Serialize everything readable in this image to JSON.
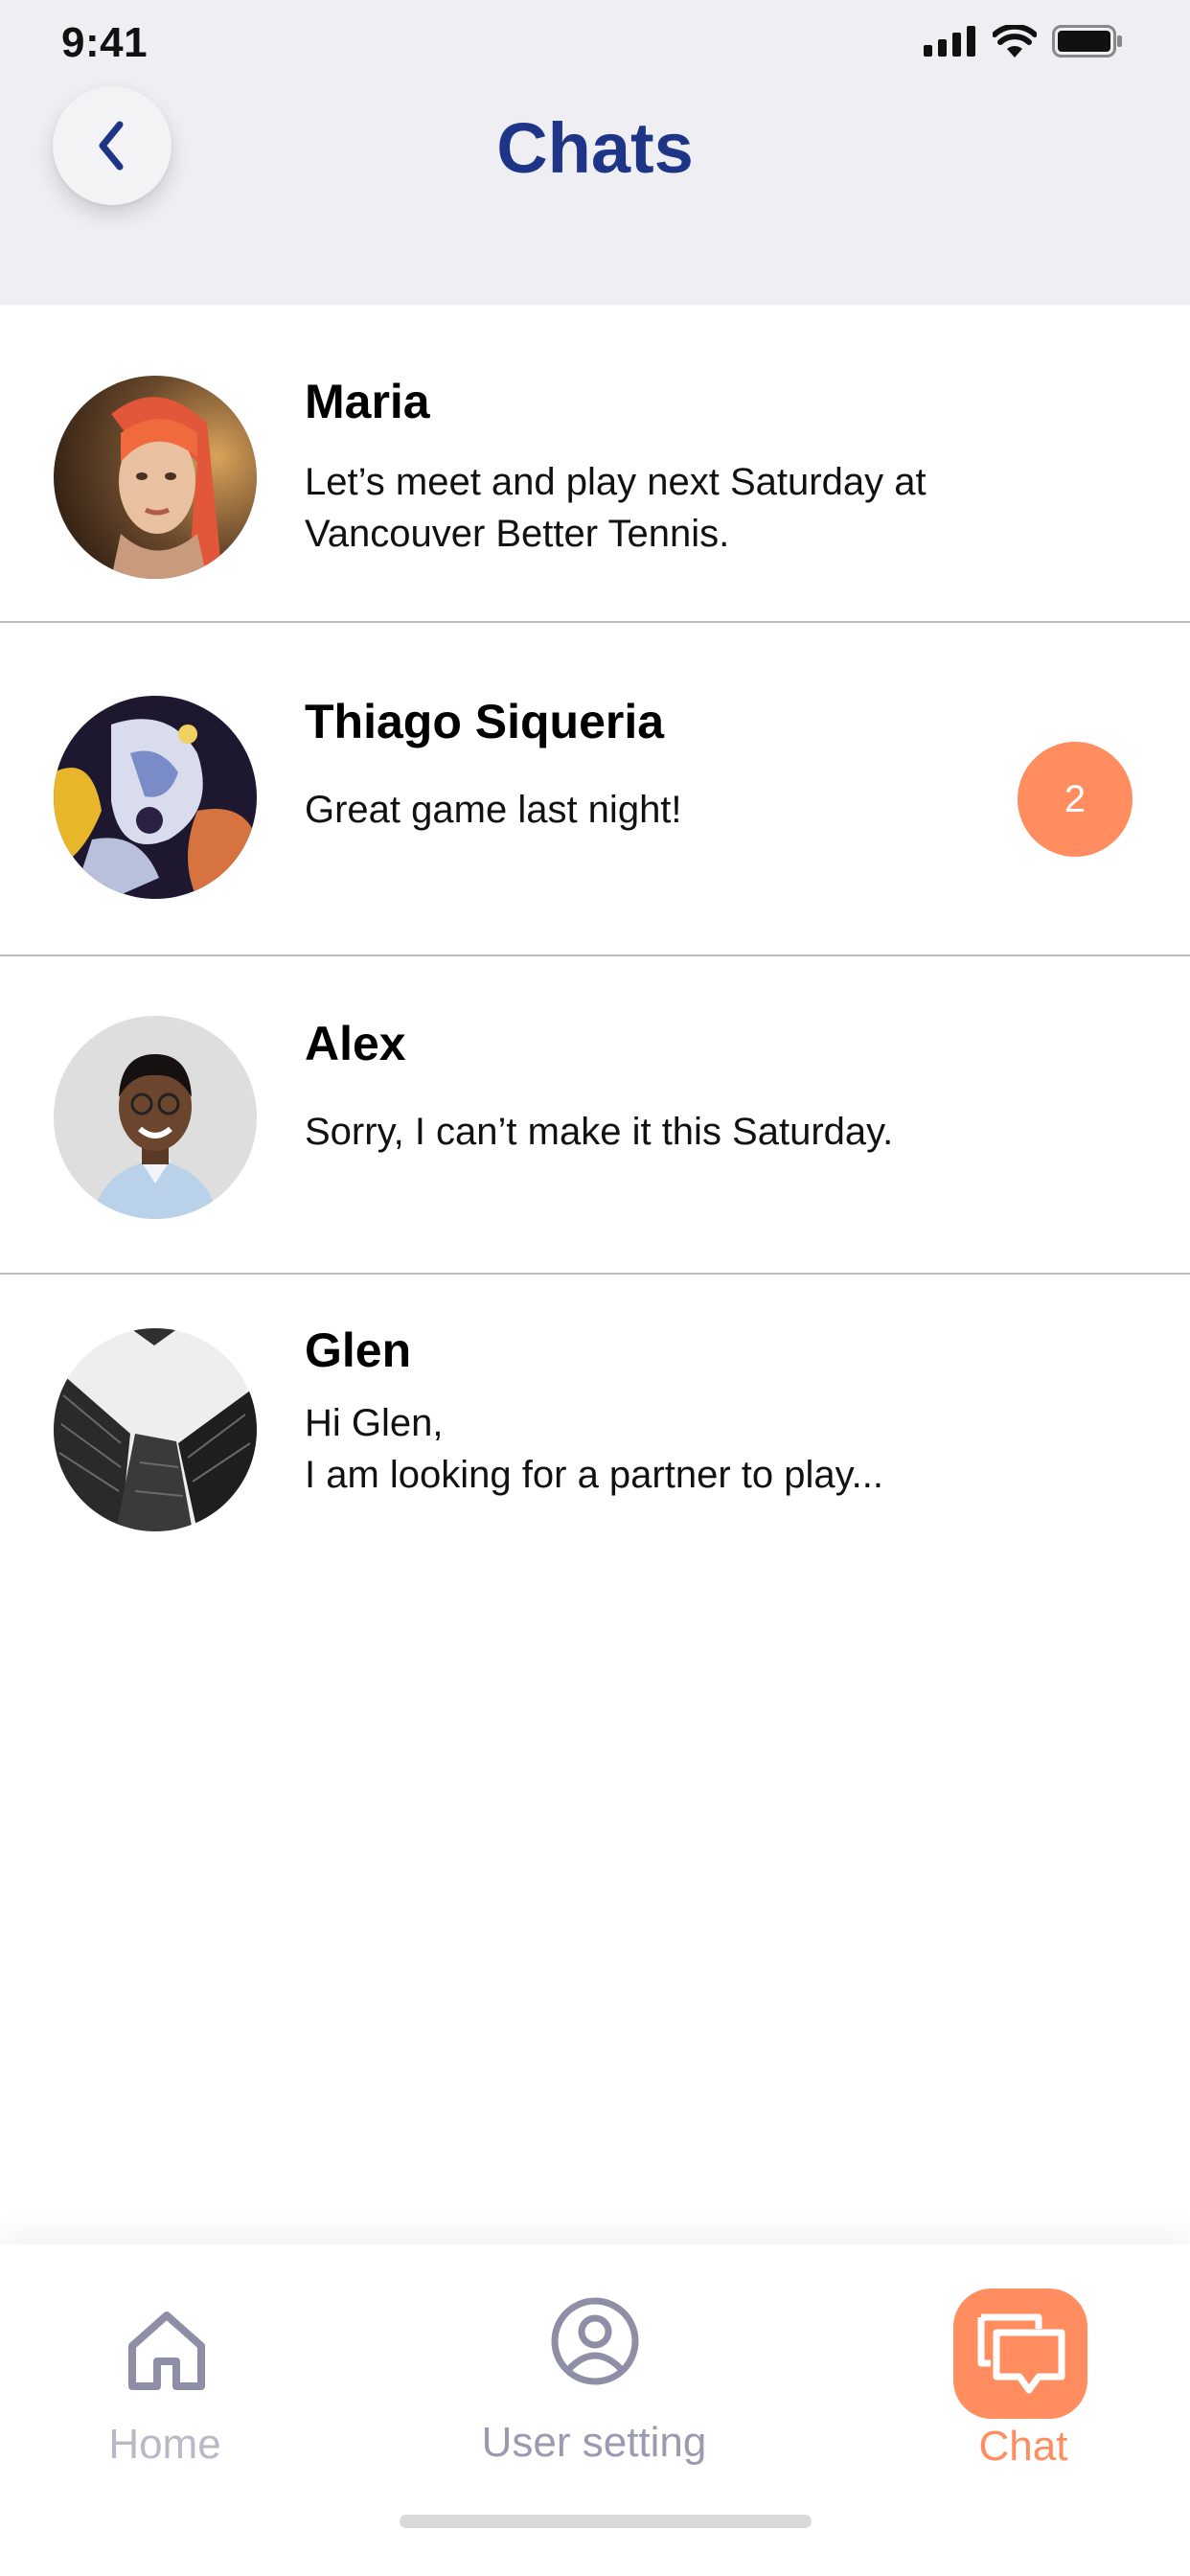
{
  "status_bar": {
    "time": "9:41"
  },
  "header": {
    "title": "Chats"
  },
  "chats": [
    {
      "name": "Maria",
      "message_lines": [
        "Let’s meet and play next Saturday at",
        "Vancouver Better Tennis."
      ],
      "avatar": "portrait-woman-red-hair"
    },
    {
      "name": "Thiago Siqueria",
      "message_lines": [
        "Great game last night!"
      ],
      "unread": "2",
      "avatar": "abstract-paint"
    },
    {
      "name": "Alex",
      "message_lines": [
        "Sorry, I can’t make it this Saturday."
      ],
      "avatar": "portrait-man-smiling"
    },
    {
      "name": "Glen",
      "message_lines": [
        "Hi Glen,",
        "I am looking for a partner to play..."
      ],
      "avatar": "skyscrapers"
    }
  ],
  "tabbar": {
    "home": "Home",
    "user_setting": "User setting",
    "chat": "Chat"
  },
  "colors": {
    "accent": "#ff8d5f",
    "title": "#1e3587",
    "inactive": "#8e8ea6"
  }
}
